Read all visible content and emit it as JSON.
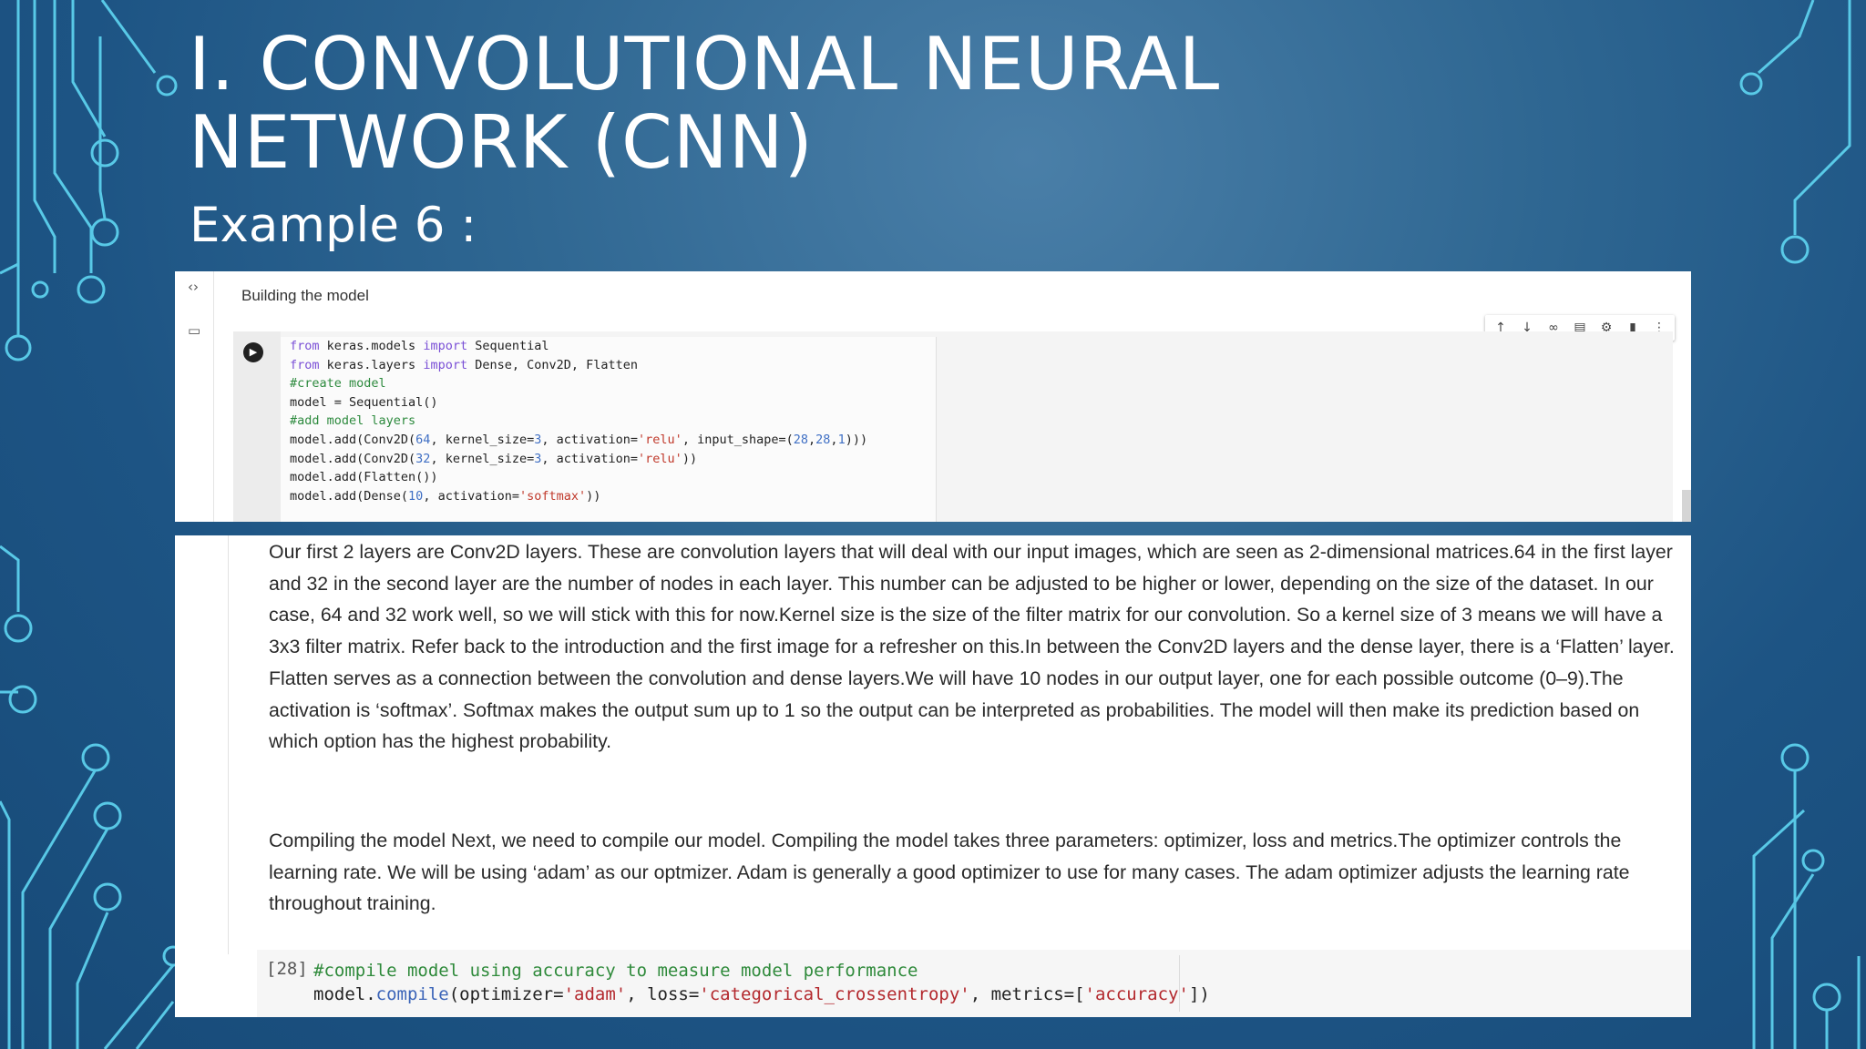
{
  "slide": {
    "title": "I. CONVOLUTIONAL NEURAL NETWORK (CNN)",
    "subtitle": "Example 6 :"
  },
  "notebook_top": {
    "rail_icons": [
      "code-icon",
      "folder-icon"
    ],
    "heading": "Building the model",
    "run_icon": "play-icon",
    "toolbar_icons": [
      "arrow-up-icon",
      "arrow-down-icon",
      "link-icon",
      "comment-icon",
      "gear-icon",
      "trash-icon",
      "more-icon"
    ],
    "code_lines": [
      "from keras.models import Sequential",
      "from keras.layers import Dense, Conv2D, Flatten",
      "#create model",
      "model = Sequential()",
      "#add model layers",
      "model.add(Conv2D(64, kernel_size=3, activation='relu', input_shape=(28,28,1)))",
      "model.add(Conv2D(32, kernel_size=3, activation='relu'))",
      "model.add(Flatten())",
      "model.add(Dense(10, activation='softmax'))"
    ]
  },
  "notebook_bottom": {
    "paragraph_1": "Our first 2 layers are Conv2D layers. These are convolution layers that will deal with our input images, which are seen as 2-dimensional matrices.64 in the first layer and 32 in the second layer are the number of nodes in each layer. This number can be adjusted to be higher or lower, depending on the size of the dataset. In our case, 64 and 32 work well, so we will stick with this for now.Kernel size is the size of the filter matrix for our convolution. So a kernel size of 3 means we will have a 3x3 filter matrix. Refer back to the introduction and the first image for a refresher on this.In between the Conv2D layers and the dense layer, there is a ‘Flatten’ layer. Flatten serves as a connection between the convolution and dense layers.We will have 10 nodes in our output layer, one for each possible outcome (0–9).The activation is ‘softmax’. Softmax makes the output sum up to 1 so the output can be interpreted as probabilities. The model will then make its prediction based on which option has the highest probability.",
    "paragraph_2": "Compiling the model Next, we need to compile our model. Compiling the model takes three parameters: optimizer, loss and metrics.The optimizer controls the learning rate. We will be using ‘adam’ as our optmizer. Adam is generally a good optimizer to use for many cases. The adam optimizer adjusts the learning rate throughout training.",
    "cell_number": "[28]",
    "cell_code_line1": "#compile model using accuracy to measure model performance",
    "cell_code_line2": "model.compile(optimizer='adam', loss='categorical_crossentropy', metrics=['accuracy'])"
  },
  "colors": {
    "background": "#1d5484",
    "circuit": "#5fd6f2",
    "title_text": "#ffffff"
  }
}
